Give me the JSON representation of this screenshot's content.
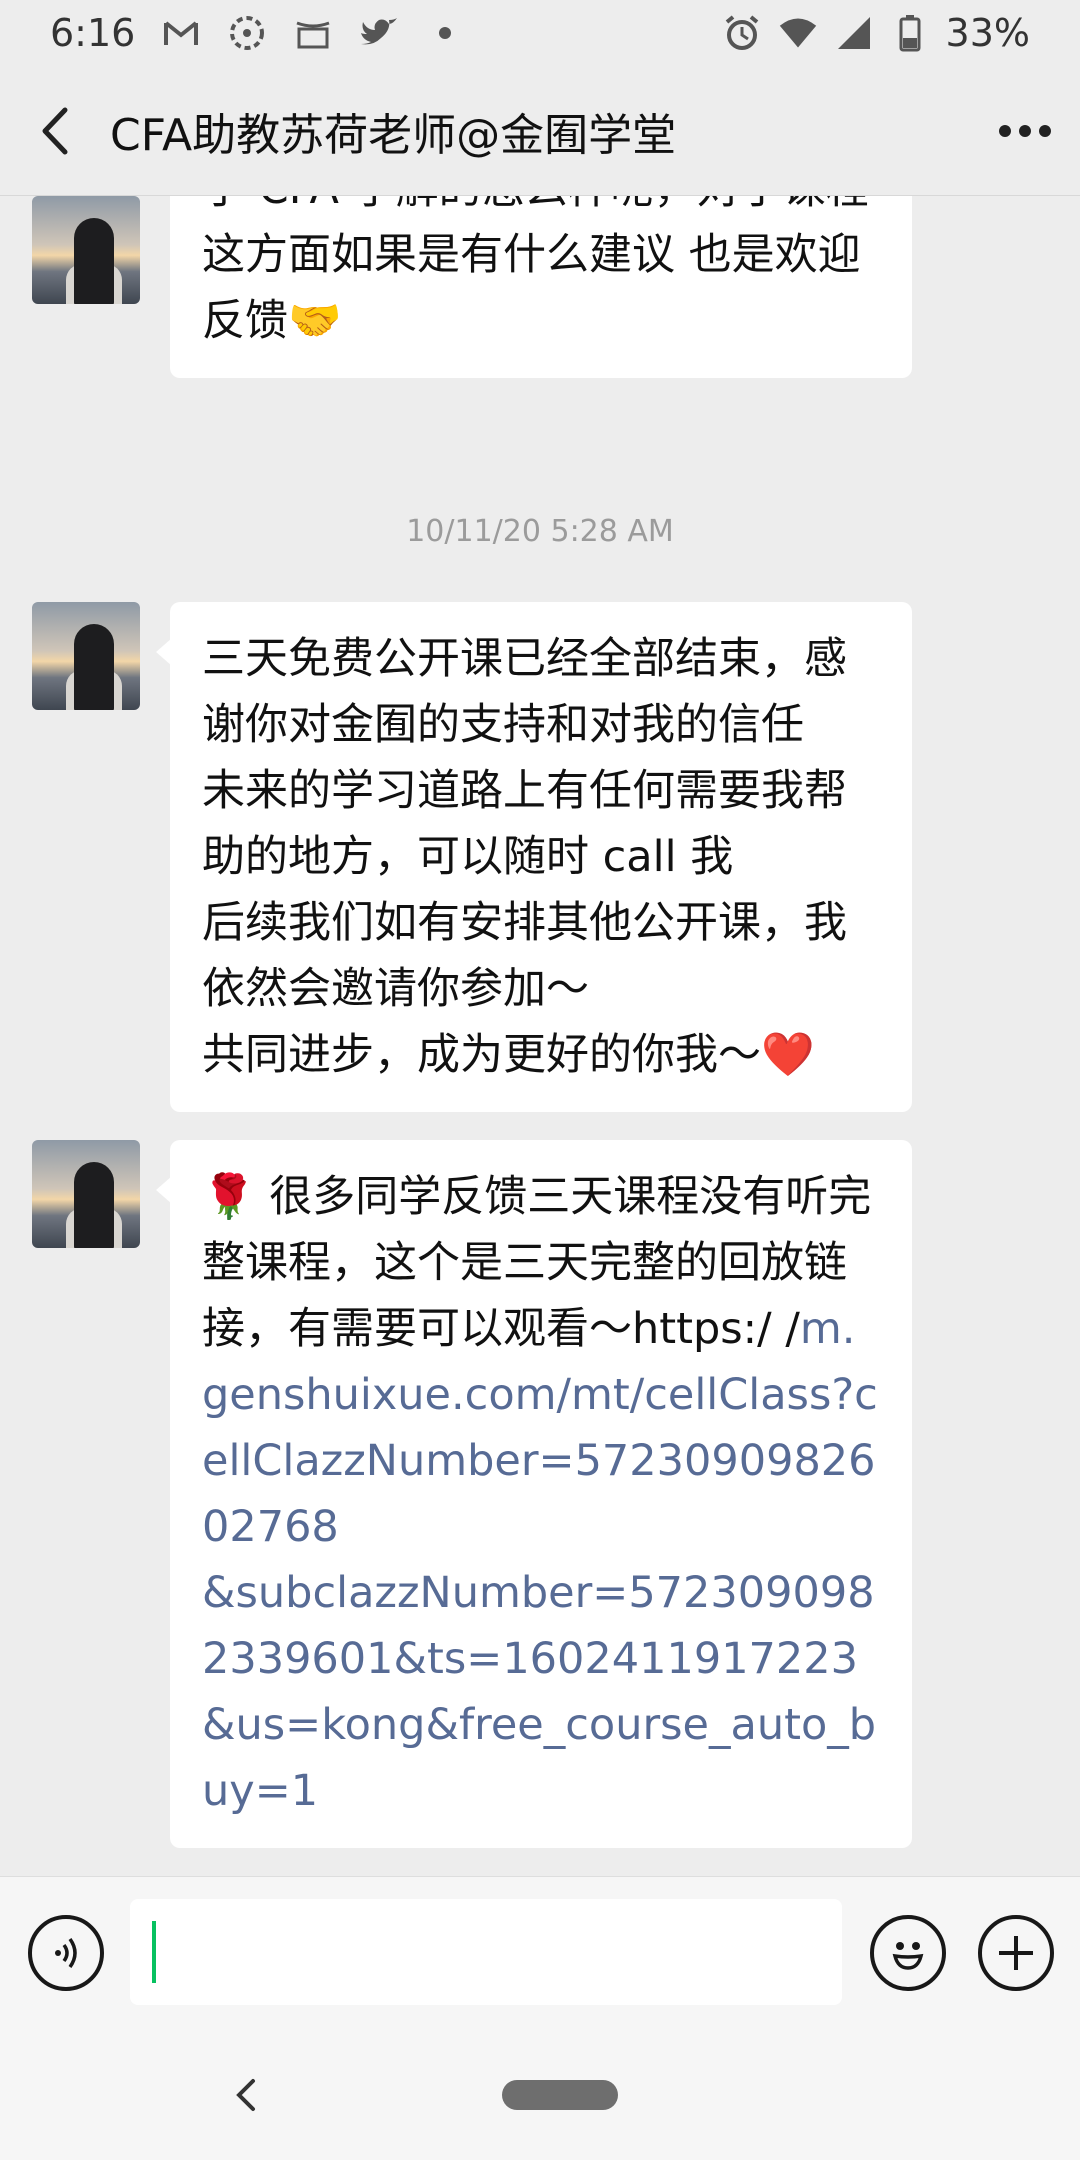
{
  "status_bar": {
    "time": "6:16",
    "notifications": [
      "gmail-icon",
      "photos-icon",
      "amazon-icon",
      "twitter-icon",
      "dot-icon"
    ],
    "battery": "33%"
  },
  "header": {
    "title": "CFA助教苏荷老师@金囿学堂"
  },
  "messages": [
    {
      "text": "三天课程已经圆满结束～🌹 这边对于 CFA 了解的怎么样呢，对于课程这方面如果是有什么建议 也是欢迎反馈🤝"
    },
    {
      "timestamp": "10/11/20 5:28 AM"
    },
    {
      "text": "三天免费公开课已经全部结束，感谢你对金囿的支持和对我的信任\n未来的学习道路上有任何需要我帮助的地方，可以随时 call 我\n后续我们如有安排其他公开课，我依然会邀请你参加～\n共同进步，成为更好的你我～❤️"
    },
    {
      "text": "🌹 很多同学反馈三天课程没有听完整课程，这个是三天完整的回放链接，有需要可以观看～https:/ /",
      "link": "m.genshuixue.com/mt/cellClass?cellClazzNumber=5723090982602768\n&subclazzNumber=5723090982339601&ts=1602411917223\n&us=kong&free_course_auto_buy=1"
    }
  ],
  "colors": {
    "background": "#ededed",
    "bubble": "#ffffff",
    "link": "#576b95",
    "cursor": "#07c160"
  }
}
